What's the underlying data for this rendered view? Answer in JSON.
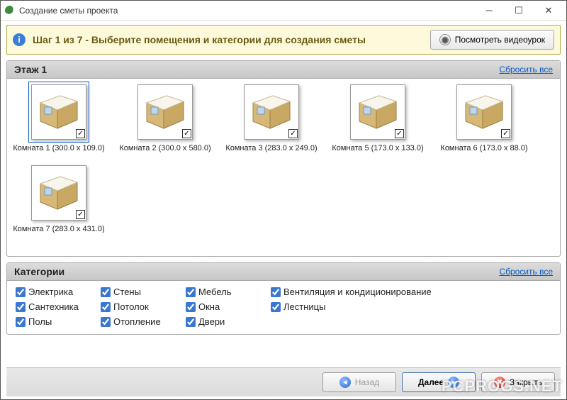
{
  "window": {
    "title": "Создание сметы проекта"
  },
  "banner": {
    "text": "Шаг 1 из 7 - Выберите помещения и категории для создания сметы",
    "video_button": "Посмотреть видеоурок"
  },
  "floor": {
    "title": "Этаж 1",
    "reset": "Сбросить все",
    "rooms": [
      {
        "label": "Комната 1 (300.0 x 109.0)",
        "selected": true,
        "checked": true
      },
      {
        "label": "Комната 2 (300.0 x 580.0)",
        "selected": false,
        "checked": true
      },
      {
        "label": "Комната 3 (283.0 x 249.0)",
        "selected": false,
        "checked": true
      },
      {
        "label": "Комната 5 (173.0 x 133.0)",
        "selected": false,
        "checked": true
      },
      {
        "label": "Комната 6 (173.0 x 88.0)",
        "selected": false,
        "checked": true
      },
      {
        "label": "Комната 7 (283.0 x 431.0)",
        "selected": false,
        "checked": true
      }
    ]
  },
  "categories": {
    "title": "Категории",
    "reset": "Сбросить все",
    "items": [
      {
        "label": "Электрика",
        "checked": true
      },
      {
        "label": "Стены",
        "checked": true
      },
      {
        "label": "Мебель",
        "checked": true
      },
      {
        "label": "Вентиляция и кондиционирование",
        "checked": true
      },
      {
        "label": "Сантехника",
        "checked": true
      },
      {
        "label": "Потолок",
        "checked": true
      },
      {
        "label": "Окна",
        "checked": true
      },
      {
        "label": "Лестницы",
        "checked": true
      },
      {
        "label": "Полы",
        "checked": true
      },
      {
        "label": "Отопление",
        "checked": true
      },
      {
        "label": "Двери",
        "checked": true
      }
    ]
  },
  "nav": {
    "back": "Назад",
    "next": "Далее",
    "close": "Закрыть"
  },
  "watermark": "PCPROGS.NET"
}
